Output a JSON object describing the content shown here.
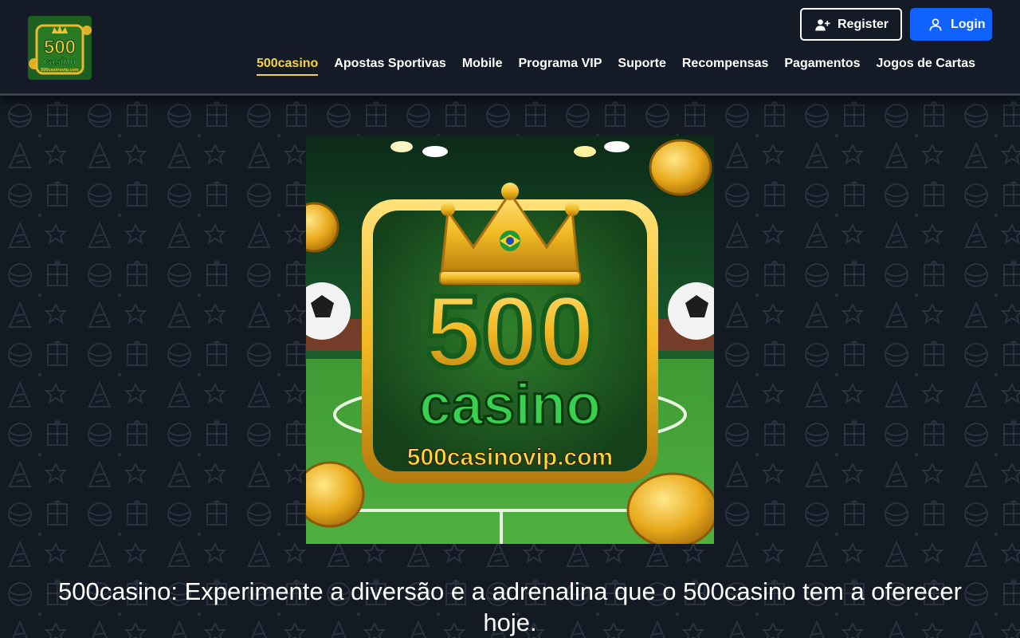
{
  "header": {
    "logo": {
      "text_big": "500",
      "text_small": "casino",
      "url_text": "500casinovip.com"
    },
    "auth": {
      "register_label": "Register",
      "login_label": "Login",
      "register_icon": "user-plus-icon",
      "login_icon": "user-icon"
    },
    "nav": [
      {
        "label": "500casino",
        "active": true
      },
      {
        "label": "Apostas Sportivas",
        "active": false
      },
      {
        "label": "Mobile",
        "active": false
      },
      {
        "label": "Programa VIP",
        "active": false
      },
      {
        "label": "Suporte",
        "active": false
      },
      {
        "label": "Recompensas",
        "active": false
      },
      {
        "label": "Pagamentos",
        "active": false
      },
      {
        "label": "Jogos de Cartas",
        "active": false
      }
    ]
  },
  "hero": {
    "big_text": "500",
    "word": "casino",
    "url_text": "500casinovip.com"
  },
  "main": {
    "title": "500casino: Experimente a diversão e a adrenalina que o 500casino tem a oferecer hoje."
  },
  "colors": {
    "background": "#131a24",
    "accent_yellow": "#f7d33c",
    "login_blue": "#0f62fe",
    "green": "#1f9a2f"
  }
}
